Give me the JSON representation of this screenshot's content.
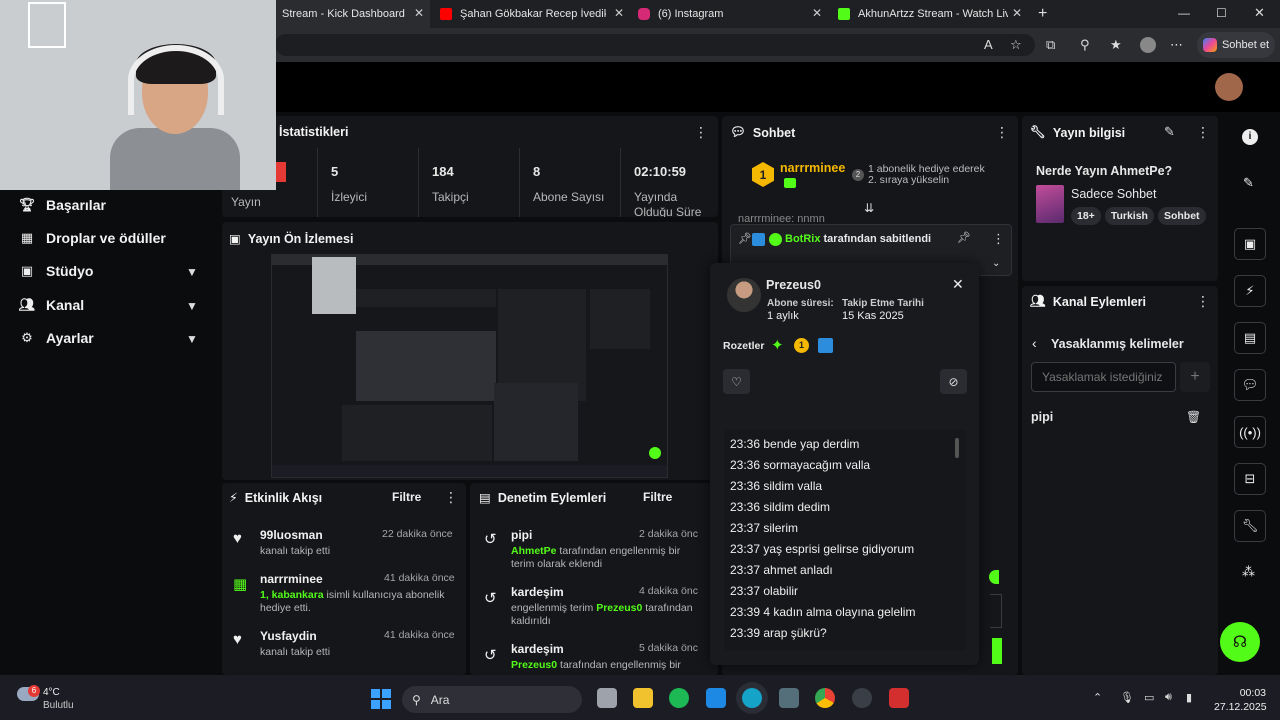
{
  "browser": {
    "tabs": [
      {
        "title": "Stream - Kick Dashboard"
      },
      {
        "title": "Şahan Gökbakar Recep İvedik Sah"
      },
      {
        "title": "(6) Instagram"
      },
      {
        "title": "AkhunArtzz Stream - Watch Live c"
      }
    ],
    "copilot_label": "Sohbet et"
  },
  "sidebar": {
    "items": [
      {
        "label": "Başarılar",
        "icon": "trophy-icon",
        "chevron": false
      },
      {
        "label": "Droplar ve ödüller",
        "icon": "gift-icon",
        "chevron": false
      },
      {
        "label": "Stüdyo",
        "icon": "studio-icon",
        "chevron": true
      },
      {
        "label": "Kanal",
        "icon": "users-icon",
        "chevron": true
      },
      {
        "label": "Ayarlar",
        "icon": "gear-icon",
        "chevron": true
      }
    ]
  },
  "stats": {
    "title": "İstatistikleri",
    "items": [
      {
        "value": "",
        "label": "Yayın"
      },
      {
        "value": "5",
        "label": "İzleyici"
      },
      {
        "value": "184",
        "label": "Takipçi"
      },
      {
        "value": "8",
        "label": "Abone Sayısı"
      },
      {
        "value": "02:10:59",
        "label": "Yayında Olduğu Süre"
      }
    ]
  },
  "preview": {
    "title": "Yayın Ön İzlemesi"
  },
  "chat": {
    "title": "Sohbet",
    "top_user": "narrrminee",
    "top_rank": "1",
    "top_gift_count": "2",
    "top_text_1": "1 abonelik hediye ederek",
    "top_text_2": "2. sıraya yükselin",
    "partial_line": "narrrminee: nnmn",
    "pinned_by": "BotRix",
    "pinned_text": "tarafından sabitlendi"
  },
  "popup": {
    "username": "Prezeus0",
    "sub_label": "Abone süresi:",
    "sub_value": "1 aylık",
    "follow_label": "Takip Etme Tarihi",
    "follow_value": "15 Kas 2025",
    "badges_label": "Rozetler",
    "badge_num": "1",
    "messages": [
      "23:36 bende yap derdim",
      "23:36 sormayacağım valla",
      "23:36 sildim valla",
      "23:36 sildim dedim",
      "23:37 silerim",
      "23:37 yaş esprisi gelirse gidiyorum",
      "23:37 ahmet anladı",
      "23:37 olabilir",
      "23:39 4 kadın alma olayına gelelim",
      "23:39 arap şükrü?"
    ]
  },
  "activity": {
    "title": "Etkinlik Akışı",
    "filter": "Filtre",
    "items": [
      {
        "name": "99luosman",
        "time": "22 dakika önce",
        "text": "kanalı takip etti",
        "highlight": "",
        "icon": "heart-icon"
      },
      {
        "name": "narrrminee",
        "time": "41 dakika önce",
        "highlight": "1, kabankara",
        "text": " isimli kullanıcıya abonelik hediye etti.",
        "icon": "gift-icon"
      },
      {
        "name": "Yusfaydin",
        "time": "41 dakika önce",
        "text": "kanalı takip etti",
        "highlight": "",
        "icon": "heart-icon"
      }
    ]
  },
  "moderation": {
    "title": "Denetim Eylemleri",
    "filter": "Filtre",
    "items": [
      {
        "term": "pipi",
        "time": "2 dakika önc",
        "pre": "",
        "actor": "AhmetPe",
        "post": " tarafından engellenmiş bir terim olarak eklendi"
      },
      {
        "term": "kardeşim",
        "time": "4 dakika önc",
        "pre": "engellenmiş terim ",
        "actor": "Prezeus0",
        "post": " tarafından kaldırıldı"
      },
      {
        "term": "kardeşim",
        "time": "5 dakika önc",
        "pre": "",
        "actor": "Prezeus0",
        "post": " tarafından engellenmiş bir"
      }
    ]
  },
  "stream_info": {
    "title": "Yayın bilgisi",
    "stream_title": "Nerde Yayın AhmetPe?",
    "category": "Sadece Sohbet",
    "tags": [
      "18+",
      "Turkish",
      "Sohbet"
    ]
  },
  "channel_actions": {
    "title": "Kanal Eylemleri",
    "subtitle": "Yasaklanmış kelimeler",
    "input_placeholder": "Yasaklamak istediğiniz",
    "add_label": "+",
    "words": [
      "pipi"
    ]
  },
  "taskbar": {
    "weather_temp": "4°C",
    "weather_text": "Bulutlu",
    "weather_badge": "6",
    "search_label": "Ara",
    "time": "00:03",
    "date": "27.12.2025"
  },
  "colors": {
    "accent": "#53fc18",
    "panel": "#15161a",
    "background": "#0b0c0e"
  }
}
